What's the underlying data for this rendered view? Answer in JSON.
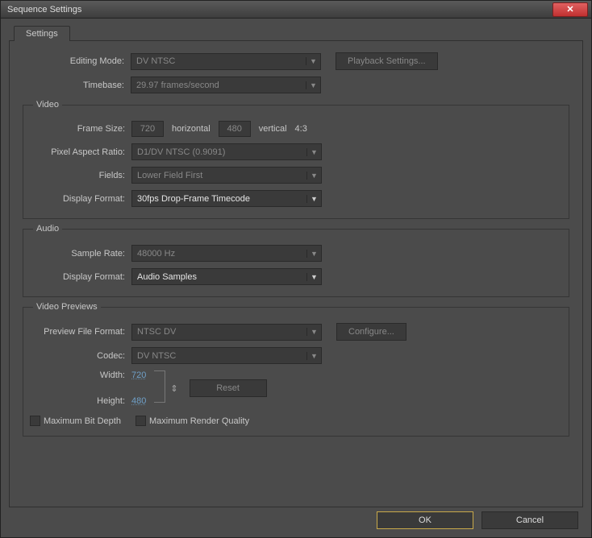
{
  "window": {
    "title": "Sequence Settings",
    "close_glyph": "✕"
  },
  "tabs": {
    "settings": "Settings"
  },
  "editing": {
    "mode_label": "Editing Mode:",
    "mode_value": "DV NTSC",
    "playback_btn": "Playback Settings...",
    "timebase_label": "Timebase:",
    "timebase_value": "29.97 frames/second"
  },
  "video": {
    "legend": "Video",
    "frame_size_label": "Frame Size:",
    "width": "720",
    "horizontal": "horizontal",
    "height": "480",
    "vertical": "vertical",
    "aspect": "4:3",
    "par_label": "Pixel Aspect Ratio:",
    "par_value": "D1/DV NTSC (0.9091)",
    "fields_label": "Fields:",
    "fields_value": "Lower Field First",
    "dispfmt_label": "Display Format:",
    "dispfmt_value": "30fps Drop-Frame Timecode"
  },
  "audio": {
    "legend": "Audio",
    "rate_label": "Sample Rate:",
    "rate_value": "48000 Hz",
    "dispfmt_label": "Display Format:",
    "dispfmt_value": "Audio Samples"
  },
  "previews": {
    "legend": "Video Previews",
    "pff_label": "Preview File Format:",
    "pff_value": "NTSC DV",
    "configure_btn": "Configure...",
    "codec_label": "Codec:",
    "codec_value": "DV NTSC",
    "width_label": "Width:",
    "width_value": "720",
    "height_label": "Height:",
    "height_value": "480",
    "link_glyph": "⇕",
    "reset_btn": "Reset",
    "max_bit_depth": "Maximum Bit Depth",
    "max_render_quality": "Maximum Render Quality"
  },
  "footer": {
    "ok": "OK",
    "cancel": "Cancel"
  },
  "glyphs": {
    "dropdown_arrow": "▼"
  }
}
